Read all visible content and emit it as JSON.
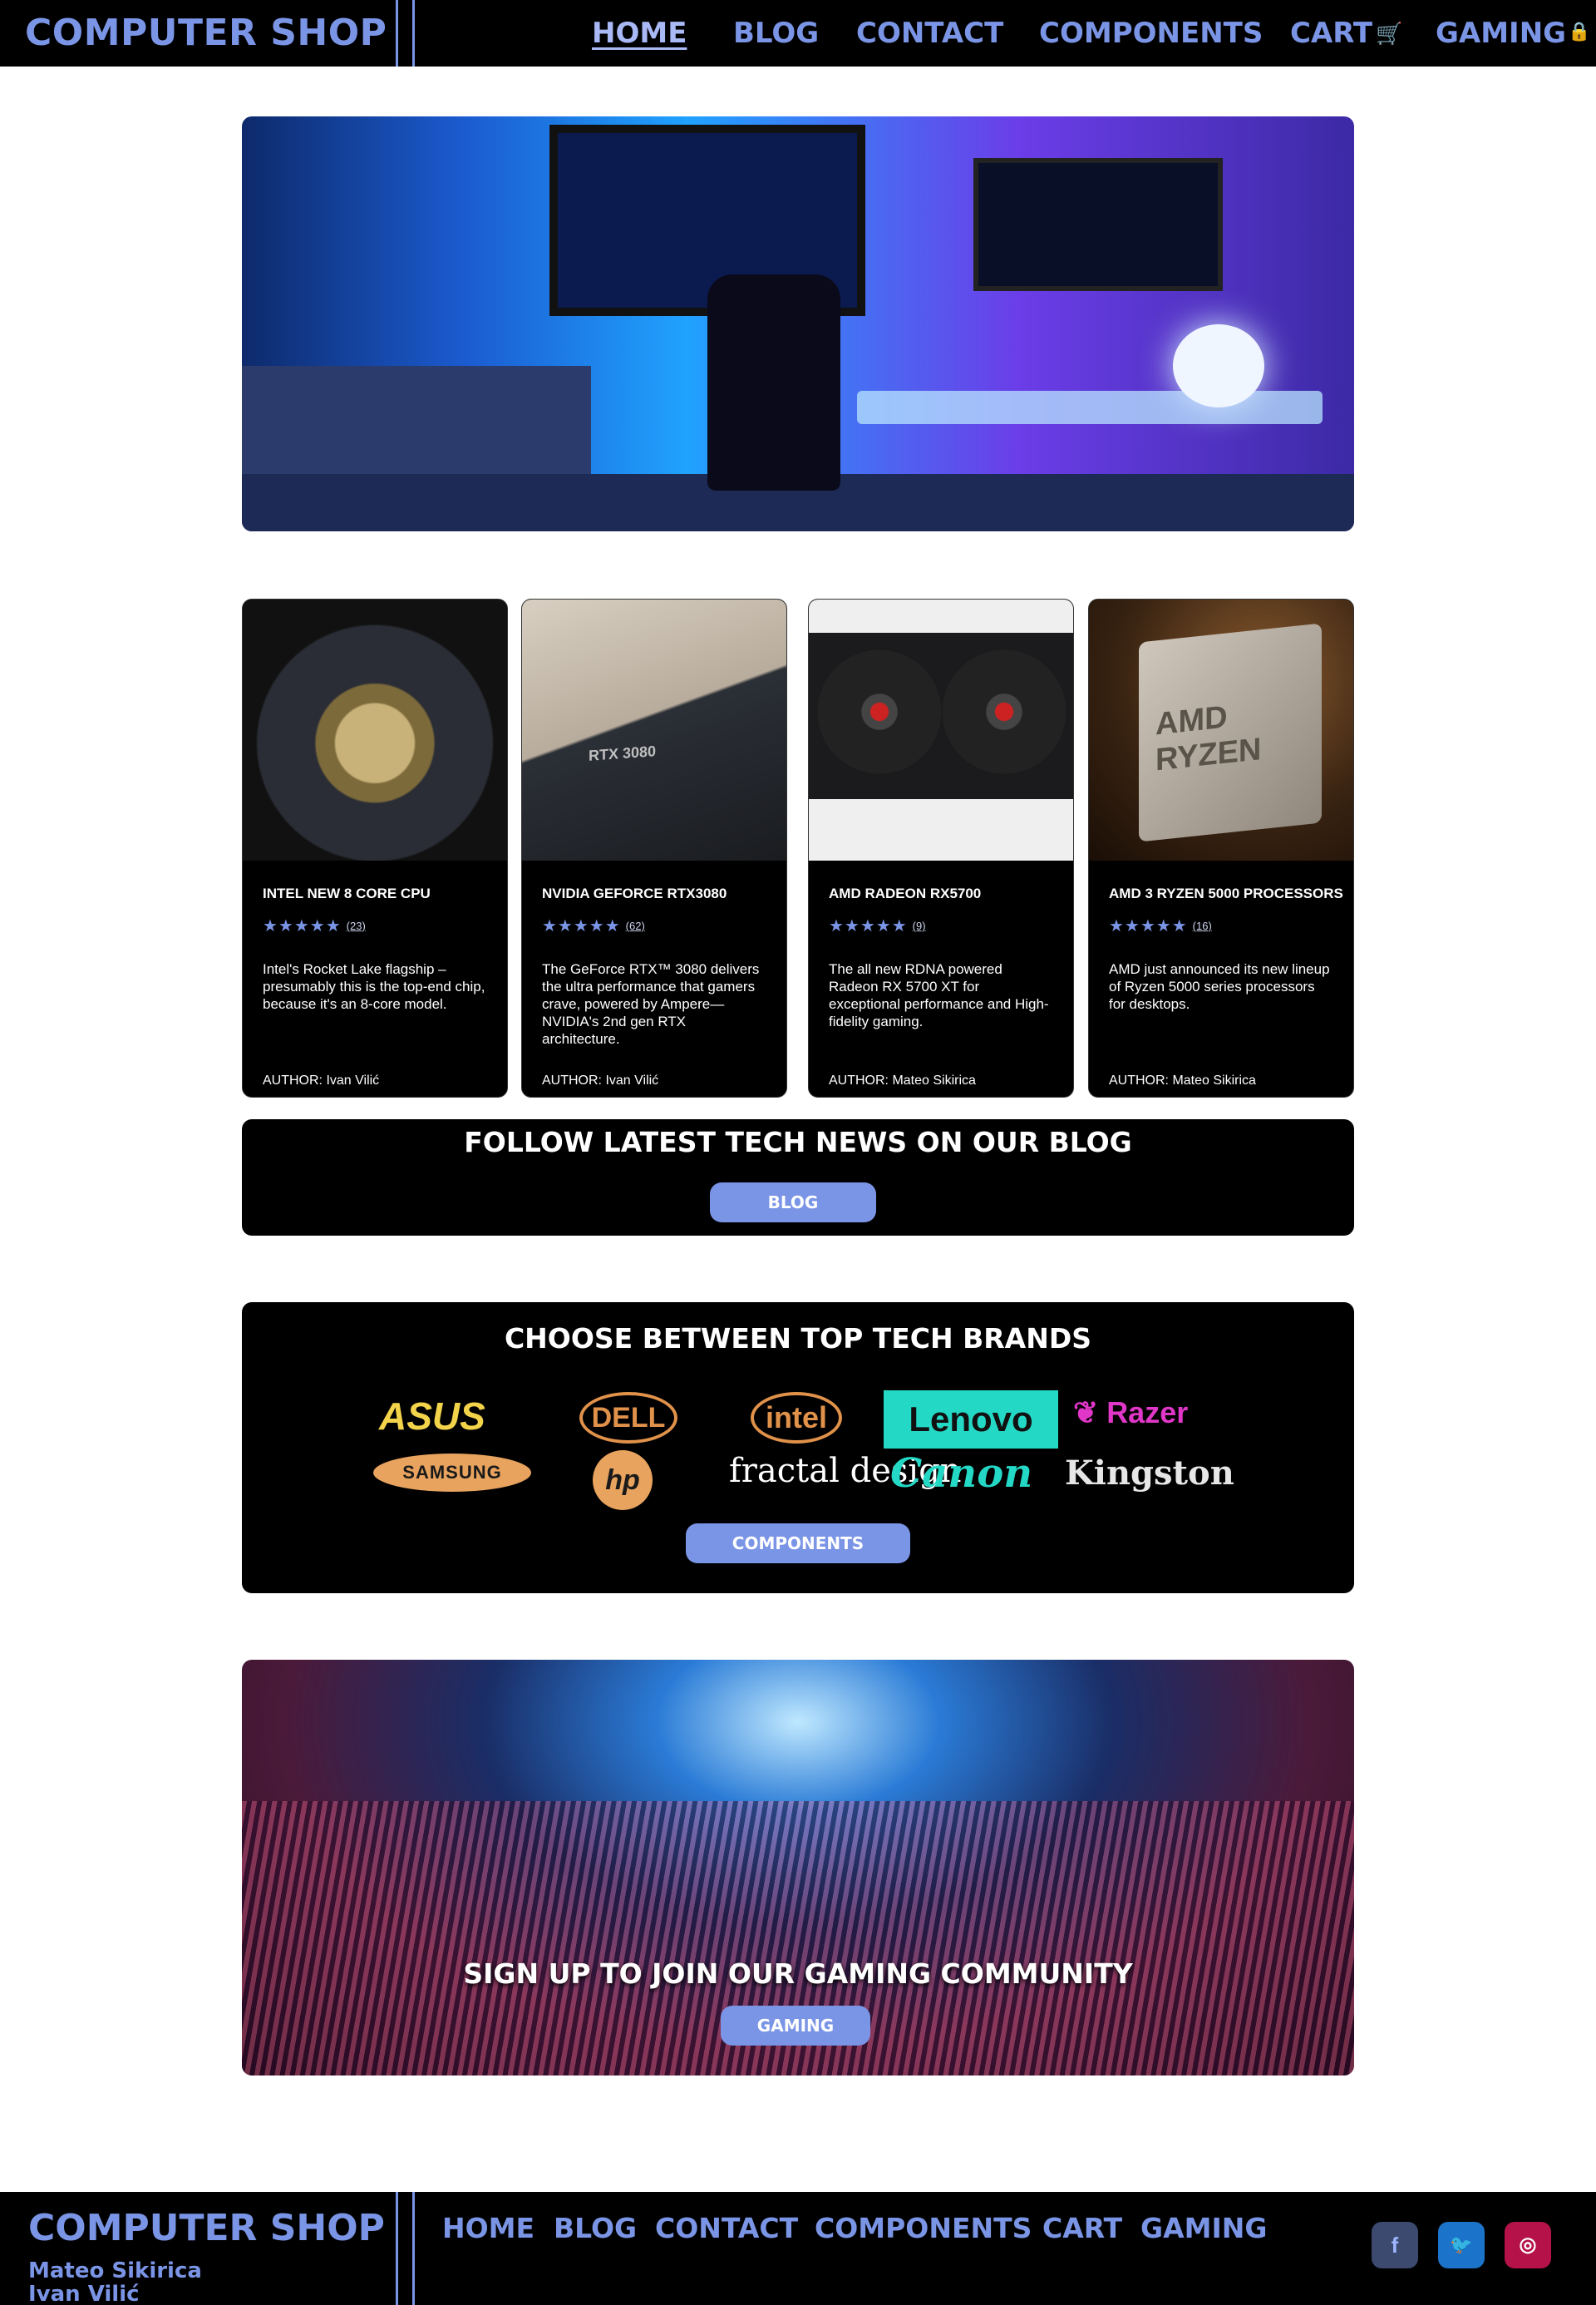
{
  "header": {
    "brand": "COMPUTER SHOP",
    "nav": [
      {
        "label": "HOME",
        "active": true
      },
      {
        "label": "BLOG"
      },
      {
        "label": "CONTACT"
      },
      {
        "label": "COMPONENTS"
      },
      {
        "label": "CART",
        "icon": "cart-icon"
      },
      {
        "label": "GAMING",
        "icon": "lock-icon"
      }
    ]
  },
  "hero": {
    "icon": "gaming-room-image"
  },
  "cards": [
    {
      "title": "INTEL NEW 8 CORE CPU",
      "rating": 5,
      "reviews": "(23)",
      "description": "Intel's Rocket Lake flagship – presumably this is the top-end chip, because it's an 8-core model.",
      "author": "AUTHOR: Ivan Vilić"
    },
    {
      "title": "NVIDIA GEFORCE RTX3080",
      "rating": 5,
      "reviews": "(62)",
      "description": "The GeForce RTX™ 3080 delivers the ultra performance that gamers crave, powered by Ampere—NVIDIA's 2nd gen RTX architecture.",
      "author": "AUTHOR: Ivan Vilić",
      "image_text": "RTX 3080"
    },
    {
      "title": "AMD RADEON RX5700",
      "rating": 5,
      "reviews": "(9)",
      "description": "The all new RDNA powered Radeon RX 5700 XT for exceptional performance and High-fidelity gaming.",
      "author": "AUTHOR: Mateo Sikirica"
    },
    {
      "title": "AMD 3 RYZEN 5000 PROCESSORS",
      "rating": 5,
      "reviews": "(16)",
      "description": "AMD just announced its new lineup of Ryzen 5000 series processors for desktops.",
      "author": "AUTHOR: Mateo Sikirica",
      "image_text": "AMD RYZEN"
    }
  ],
  "blog_band": {
    "title": "FOLLOW LATEST TECH NEWS ON OUR BLOG",
    "button": "BLOG"
  },
  "brands": {
    "title": "CHOOSE BETWEEN TOP TECH BRANDS",
    "logos": [
      "ASUS",
      "DELL",
      "intel",
      "Lenovo",
      "Razer",
      "SAMSUNG",
      "hp",
      "fractal design",
      "Canon",
      "Kingston"
    ],
    "button": "COMPONENTS"
  },
  "gaming_band": {
    "title": "SIGN UP TO JOIN OUR GAMING COMMUNITY",
    "button": "GAMING"
  },
  "footer": {
    "brand": "COMPUTER SHOP",
    "authors": [
      "Mateo Sikirica",
      "Ivan Vilić"
    ],
    "nav": [
      "HOME",
      "BLOG",
      "CONTACT",
      "COMPONENTS",
      "CART",
      "GAMING"
    ],
    "social": [
      "facebook-icon",
      "twitter-icon",
      "instagram-icon"
    ]
  },
  "colors": {
    "accent": "#7b95e6",
    "background": "#000000",
    "page": "#ffffff"
  }
}
